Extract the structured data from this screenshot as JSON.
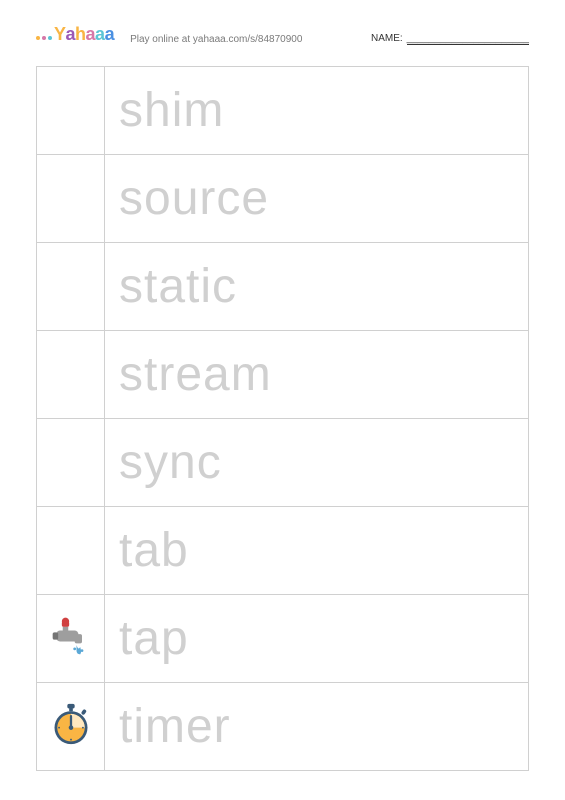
{
  "header": {
    "logo_text": "Yahaaa",
    "play_online": "Play online at yahaaa.com/s/84870900",
    "name_label": "NAME:",
    "name_value": "______________________"
  },
  "worksheet": {
    "rows": [
      {
        "icon": null,
        "word": "shim"
      },
      {
        "icon": null,
        "word": "source"
      },
      {
        "icon": null,
        "word": "static"
      },
      {
        "icon": null,
        "word": "stream"
      },
      {
        "icon": null,
        "word": "sync"
      },
      {
        "icon": null,
        "word": "tab"
      },
      {
        "icon": "tap-icon",
        "word": "tap"
      },
      {
        "icon": "timer-icon",
        "word": "timer"
      }
    ]
  }
}
